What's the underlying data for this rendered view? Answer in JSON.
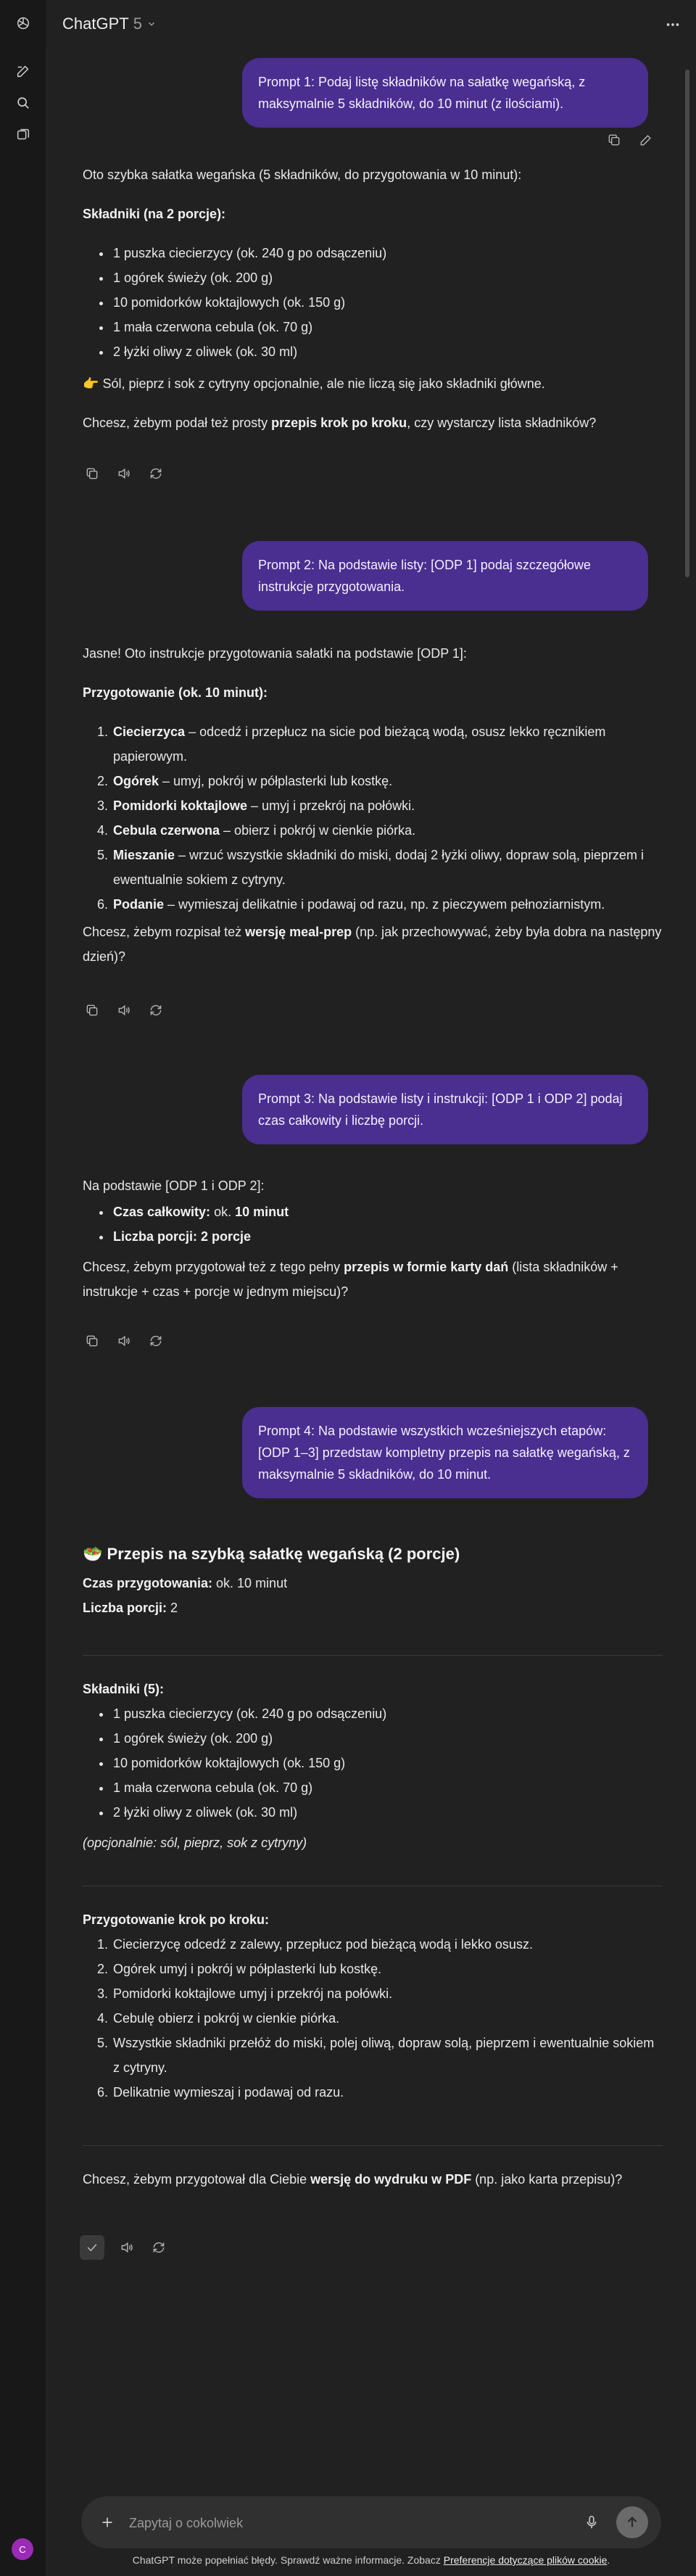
{
  "header": {
    "model_name": "ChatGPT",
    "model_version": "5"
  },
  "composer": {
    "placeholder": "Zapytaj o cokolwiek"
  },
  "footer": {
    "disclaimer": "ChatGPT może popełniać błędy. Sprawdź ważne informacje. Zobacz",
    "link": "Preferencje dotyczące plików cookie",
    "end": "."
  },
  "avatar": {
    "initial": "C"
  },
  "colors": {
    "user_bubble": "#4a2e90",
    "background": "#212121",
    "rail": "#181818",
    "avatar": "#9b2bb5"
  },
  "messages": {
    "p1": "Prompt 1: Podaj listę składników na sałatkę wegańską, z maksymalnie 5 składników, do 10 minut (z ilościami).",
    "a1": {
      "intro": "Oto szybka sałatka wegańska (5 składników, do przygotowania w 10 minut):",
      "heading": "Składniki (na 2 porcje):",
      "items": [
        "1 puszka ciecierzycy (ok. 240 g po odsączeniu)",
        "1 ogórek świeży (ok. 200 g)",
        "10 pomidorków koktajlowych (ok. 150 g)",
        "1 mała czerwona cebula (ok. 70 g)",
        "2 łyżki oliwy z oliwek (ok. 30 ml)"
      ],
      "note_emoji": "👉",
      "note": "Sól, pieprz i sok z cytryny opcjonalnie, ale nie liczą się jako składniki główne.",
      "q_before": "Chcesz, żebym podał też prosty ",
      "q_bold": "przepis krok po kroku",
      "q_after": ", czy wystarczy lista składników?"
    },
    "p2": "Prompt 2: Na podstawie listy: [ODP 1] podaj szczegółowe instrukcje przygotowania.",
    "a2": {
      "intro": "Jasne! Oto instrukcje przygotowania sałatki na podstawie [ODP 1]:",
      "heading": "Przygotowanie (ok. 10 minut):",
      "steps": [
        {
          "b": "Ciecierzyca",
          "t": " – odcedź i przepłucz na sicie pod bieżącą wodą, osusz lekko ręcznikiem papierowym."
        },
        {
          "b": "Ogórek",
          "t": " – umyj, pokrój w półplasterki lub kostkę."
        },
        {
          "b": "Pomidorki koktajlowe",
          "t": " – umyj i przekrój na połówki."
        },
        {
          "b": "Cebula czerwona",
          "t": " – obierz i pokrój w cienkie piórka."
        },
        {
          "b": "Mieszanie",
          "t": " – wrzuć wszystkie składniki do miski, dodaj 2 łyżki oliwy, dopraw solą, pieprzem i ewentualnie sokiem z cytryny."
        },
        {
          "b": "Podanie",
          "t": " – wymieszaj delikatnie i podawaj od razu, np. z pieczywem pełnoziarnistym."
        }
      ],
      "q_before": "Chcesz, żebym rozpisał też ",
      "q_bold": "wersję meal-prep",
      "q_after": " (np. jak przechowywać, żeby była dobra na następny dzień)?"
    },
    "p3": "Prompt 3: Na podstawie listy i instrukcji: [ODP 1 i ODP 2] podaj czas całkowity i liczbę porcji.",
    "a3": {
      "intro": "Na podstawie [ODP 1 i ODP 2]:",
      "time_label": "Czas całkowity:",
      "time_pre": " ok. ",
      "time_value": "10 minut",
      "portions_label": "Liczba porcji:",
      "portions_value": "2 porcje",
      "q_before": "Chcesz, żebym przygotował też z tego pełny ",
      "q_bold": "przepis w formie karty dań",
      "q_after": " (lista składników + instrukcje + czas + porcje w jednym miejscu)?"
    },
    "p4": "Prompt 4: Na podstawie wszystkich wcześniejszych etapów: [ODP 1–3] przedstaw kompletny przepis na sałatkę wegańską, z maksymalnie 5 składników, do 10 minut.",
    "a4": {
      "title_emoji": "🥗",
      "title": "Przepis na szybką sałatkę wegańską (2 porcje)",
      "time_label": "Czas przygotowania:",
      "time_value": " ok. 10 minut",
      "portions_label": "Liczba porcji:",
      "portions_value": " 2",
      "ingredients_heading": "Składniki (5):",
      "ingredients": [
        "1 puszka ciecierzycy (ok. 240 g po odsączeniu)",
        "1 ogórek świeży (ok. 200 g)",
        "10 pomidorków koktajlowych (ok. 150 g)",
        "1 mała czerwona cebula (ok. 70 g)",
        "2 łyżki oliwy z oliwek (ok. 30 ml)"
      ],
      "optional": "(opcjonalnie: sól, pieprz, sok z cytryny)",
      "steps_heading": "Przygotowanie krok po kroku:",
      "steps": [
        "Ciecierzycę odcedź z zalewy, przepłucz pod bieżącą wodą i lekko osusz.",
        "Ogórek umyj i pokrój w półplasterki lub kostkę.",
        "Pomidorki koktajlowe umyj i przekrój na połówki.",
        "Cebulę obierz i pokrój w cienkie piórka.",
        "Wszystkie składniki przełóż do miski, polej oliwą, dopraw solą, pieprzem i ewentualnie sokiem z cytryny.",
        "Delikatnie wymieszaj i podawaj od razu."
      ],
      "q_before": "Chcesz, żebym przygotował dla Ciebie ",
      "q_bold": "wersję do wydruku w PDF",
      "q_after": " (np. jako karta przepisu)?"
    }
  }
}
